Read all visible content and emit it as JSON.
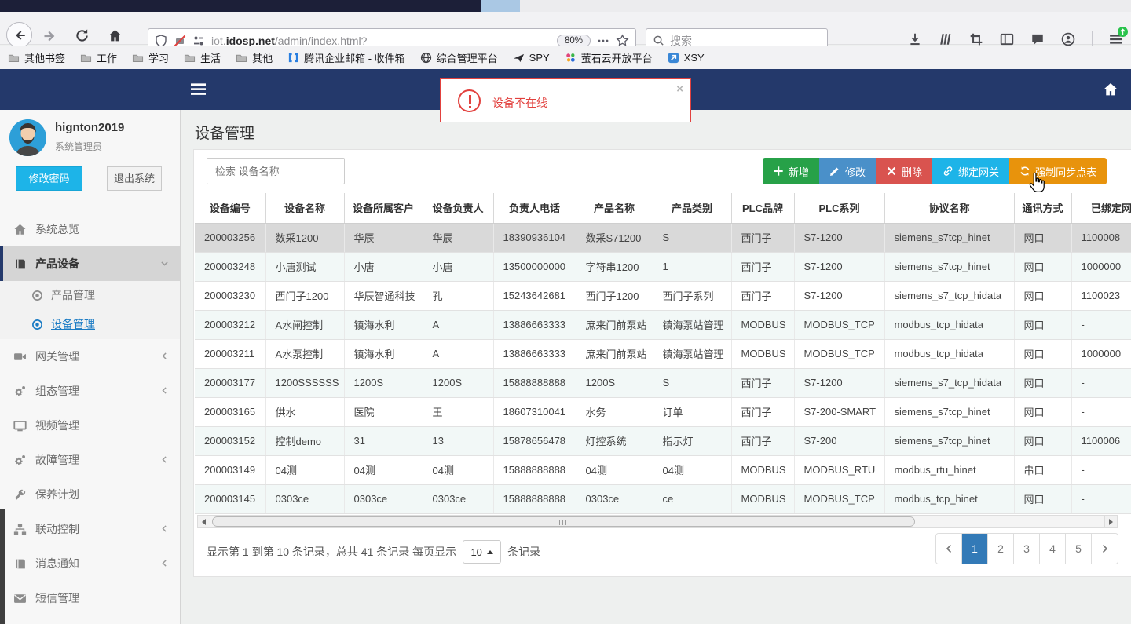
{
  "browser": {
    "url_host_prefix": "iot.",
    "url_domain": "idosp.net",
    "url_path": "/admin/index.html?",
    "zoom_badge": "80%",
    "search_placeholder": "搜索",
    "bookmarks": [
      "其他书签",
      "工作",
      "学习",
      "生活",
      "其他",
      "腾讯企业邮箱 - 收件箱",
      "综合管理平台",
      "SPY",
      "萤石云开放平台",
      "XSY"
    ]
  },
  "alert": {
    "message": "设备不在线",
    "close": "×"
  },
  "sidebar": {
    "username": "hignton2019",
    "role": "系统管理员",
    "change_password": "修改密码",
    "logout": "退出系统",
    "menu": [
      {
        "label": "系统总览"
      },
      {
        "label": "产品设备"
      },
      {
        "label": "产品管理"
      },
      {
        "label": "设备管理"
      },
      {
        "label": "网关管理"
      },
      {
        "label": "组态管理"
      },
      {
        "label": "视频管理"
      },
      {
        "label": "故障管理"
      },
      {
        "label": "保养计划"
      },
      {
        "label": "联动控制"
      },
      {
        "label": "消息通知"
      },
      {
        "label": "短信管理"
      }
    ]
  },
  "page": {
    "title": "设备管理",
    "search_placeholder": "检索 设备名称",
    "buttons": [
      {
        "label": "新增"
      },
      {
        "label": "修改"
      },
      {
        "label": "删除"
      },
      {
        "label": "绑定网关"
      },
      {
        "label": "强制同步点表"
      }
    ]
  },
  "table": {
    "headers": [
      "设备编号",
      "设备名称",
      "设备所属客户",
      "设备负责人",
      "负责人电话",
      "产品名称",
      "产品类别",
      "PLC品牌",
      "PLC系列",
      "协议名称",
      "通讯方式",
      "已绑定网关"
    ],
    "rows": [
      [
        "200003256",
        "数采1200",
        "华辰",
        "华辰",
        "18390936104",
        "数采S71200",
        "S",
        "西门子",
        "S7-1200",
        "siemens_s7tcp_hinet",
        "网口",
        "1100008"
      ],
      [
        "200003248",
        "小唐测试",
        "小唐",
        "小唐",
        "13500000000",
        "字符串1200",
        "1",
        "西门子",
        "S7-1200",
        "siemens_s7tcp_hinet",
        "网口",
        "1000000"
      ],
      [
        "200003230",
        "西门子1200",
        "华辰智通科技",
        "孔",
        "15243642681",
        "西门子1200",
        "西门子系列",
        "西门子",
        "S7-1200",
        "siemens_s7_tcp_hidata",
        "网口",
        "1100023"
      ],
      [
        "200003212",
        "A水闸控制",
        "镇海水利",
        "A",
        "13886663333",
        "庶来门前泵站",
        "镇海泵站管理",
        "MODBUS",
        "MODBUS_TCP",
        "modbus_tcp_hidata",
        "网口",
        "-"
      ],
      [
        "200003211",
        "A水泵控制",
        "镇海水利",
        "A",
        "13886663333",
        "庶来门前泵站",
        "镇海泵站管理",
        "MODBUS",
        "MODBUS_TCP",
        "modbus_tcp_hidata",
        "网口",
        "1000000"
      ],
      [
        "200003177",
        "1200SSSSSS",
        "1200S",
        "1200S",
        "15888888888",
        "1200S",
        "S",
        "西门子",
        "S7-1200",
        "siemens_s7_tcp_hidata",
        "网口",
        "-"
      ],
      [
        "200003165",
        "供水",
        "医院",
        "王",
        "18607310041",
        "水务",
        "订单",
        "西门子",
        "S7-200-SMART",
        "siemens_s7tcp_hinet",
        "网口",
        "-"
      ],
      [
        "200003152",
        "控制demo",
        "31",
        "13",
        "15878656478",
        "灯控系统",
        "指示灯",
        "西门子",
        "S7-200",
        "siemens_s7tcp_hinet",
        "网口",
        "1100006"
      ],
      [
        "200003149",
        "04测",
        "04测",
        "04测",
        "15888888888",
        "04测",
        "04测",
        "MODBUS",
        "MODBUS_RTU",
        "modbus_rtu_hinet",
        "串口",
        "-"
      ],
      [
        "200003145",
        "0303ce",
        "0303ce",
        "0303ce",
        "15888888888",
        "0303ce",
        "ce",
        "MODBUS",
        "MODBUS_TCP",
        "modbus_tcp_hinet",
        "网口",
        "-"
      ]
    ]
  },
  "footer": {
    "info_prefix": "显示第 1 到第 10 条记录，总共 41 条记录 每页显示",
    "page_size": "10",
    "info_suffix": "条记录",
    "pages": [
      "1",
      "2",
      "3",
      "4",
      "5"
    ]
  }
}
